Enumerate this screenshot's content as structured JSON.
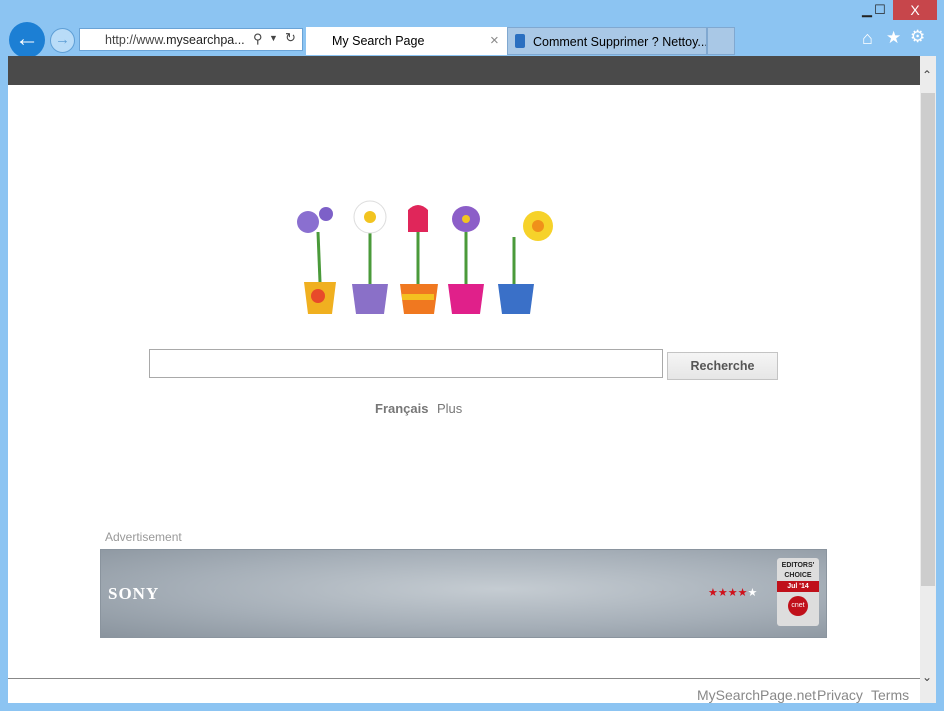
{
  "window": {
    "minimize": "▁",
    "maximize": "☐",
    "close": "X"
  },
  "nav": {
    "back_icon": "arrow-left",
    "forward_icon": "arrow-right"
  },
  "address": {
    "prefix": "http://www.",
    "domain": "mysearchpa..."
  },
  "tabs": [
    {
      "label": "My Search Page",
      "close": "×"
    },
    {
      "label": "Comment Supprimer ? Nettoy..."
    }
  ],
  "toolbar": {
    "home": "⌂",
    "favorites": "★",
    "settings": "⚙"
  },
  "search": {
    "value": "",
    "button": "Recherche"
  },
  "links": {
    "lang": "Français",
    "more": "Plus"
  },
  "ad": {
    "label": "Advertisement",
    "brand": "SONY",
    "stars": "★★★★",
    "star_empty": "★",
    "badge_top": "EDITORS' CHOICE",
    "badge_date": "Jul '14",
    "badge_logo": "cnet",
    "rating": 4
  },
  "footer": {
    "site": "MySearchPage.net",
    "privacy": "Privacy",
    "terms": "Terms"
  }
}
